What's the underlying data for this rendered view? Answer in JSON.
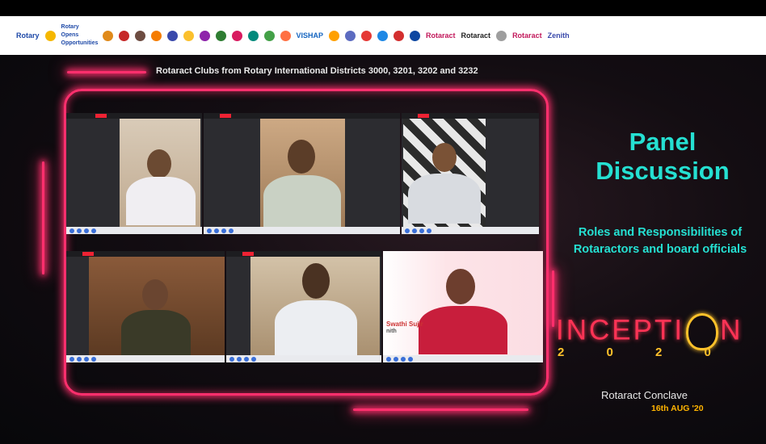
{
  "header": {
    "logos": [
      "Rotary",
      "Rotary Opens Opportunities",
      "VISHAP",
      "Rotaract",
      "Rotaract",
      "Rotaract",
      "Zenith"
    ]
  },
  "banner": {
    "districts_text": "Rotaract Clubs from Rotary International Districts 3000, 3201, 3202 and 3232"
  },
  "video_grid": {
    "participants": [
      {
        "name": ""
      },
      {
        "name": ""
      },
      {
        "name": ""
      },
      {
        "name": ""
      },
      {
        "name": ""
      },
      {
        "name": "Swathi Sujir"
      }
    ],
    "highlight_org": "nith"
  },
  "panel": {
    "title_line1": "Panel",
    "title_line2": "Discussion",
    "subtitle_line1": "Roles and Responsibilities of",
    "subtitle_line2": "Rotaractors and board officials"
  },
  "event": {
    "name": "INCEPTI",
    "name_end": "N",
    "year": "2 0 2 0",
    "conclave": "Rotaract Conclave",
    "date": "16th AUG '20"
  },
  "colors": {
    "neon_pink": "#ff2f6d",
    "teal": "#25e0d2",
    "gold": "#ffc22b",
    "background": "#0a0a0c"
  }
}
